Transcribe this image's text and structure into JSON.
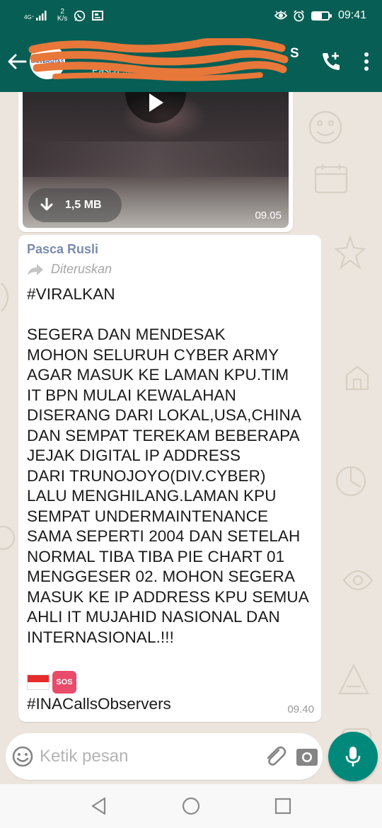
{
  "status_bar": {
    "network": "4G⁺",
    "speed_value": "2",
    "speed_unit": "K/s",
    "time": "09:41",
    "icons": [
      "signal-icon",
      "whatsapp-icon",
      "gallery-icon",
      "eye-icon",
      "alarm-icon",
      "battery-icon"
    ],
    "battery_level": 0.6
  },
  "header": {
    "title": "S",
    "subtitle": "Pasca ...",
    "avatar_text": "UNIVERSITAS"
  },
  "video_message": {
    "size": "1,5 MB",
    "time": "09.05"
  },
  "message": {
    "sender": "Pasca Rusli",
    "forwarded_label": "Diteruskan",
    "body": "#VIRALKAN\n\nSEGERA DAN MENDESAK\nMOHON SELURUH CYBER ARMY\nAGAR MASUK KE LAMAN KPU.TIM\nIT BPN MULAI KEWALAHAN\nDISERANG DARI LOKAL,USA,CHINA\nDAN SEMPAT TEREKAM BEBERAPA\nJEJAK DIGITAL IP ADDRESS\nDARI TRUNOJOYO(DIV.CYBER)\nLALU MENGHILANG.LAMAN KPU\nSEMPAT UNDERMAINTENANCE\nSAMA SEPERTI 2004 DAN SETELAH\nNORMAL TIBA TIBA PIE CHART 01\nMENGGESER 02. MOHON SEGERA\nMASUK KE IP ADDRESS KPU SEMUA\nAHLI IT MUJAHID NASIONAL DAN\nINTERNASIONAL.!!!",
    "sos_label": "SOS",
    "hashtag": "#INACallsObservers",
    "time": "09.40"
  },
  "composer": {
    "placeholder": "Ketik pesan"
  },
  "colors": {
    "header": "#075e54",
    "accent": "#00897b",
    "wallpaper": "#ece5dd",
    "sender": "#7a8bae"
  }
}
